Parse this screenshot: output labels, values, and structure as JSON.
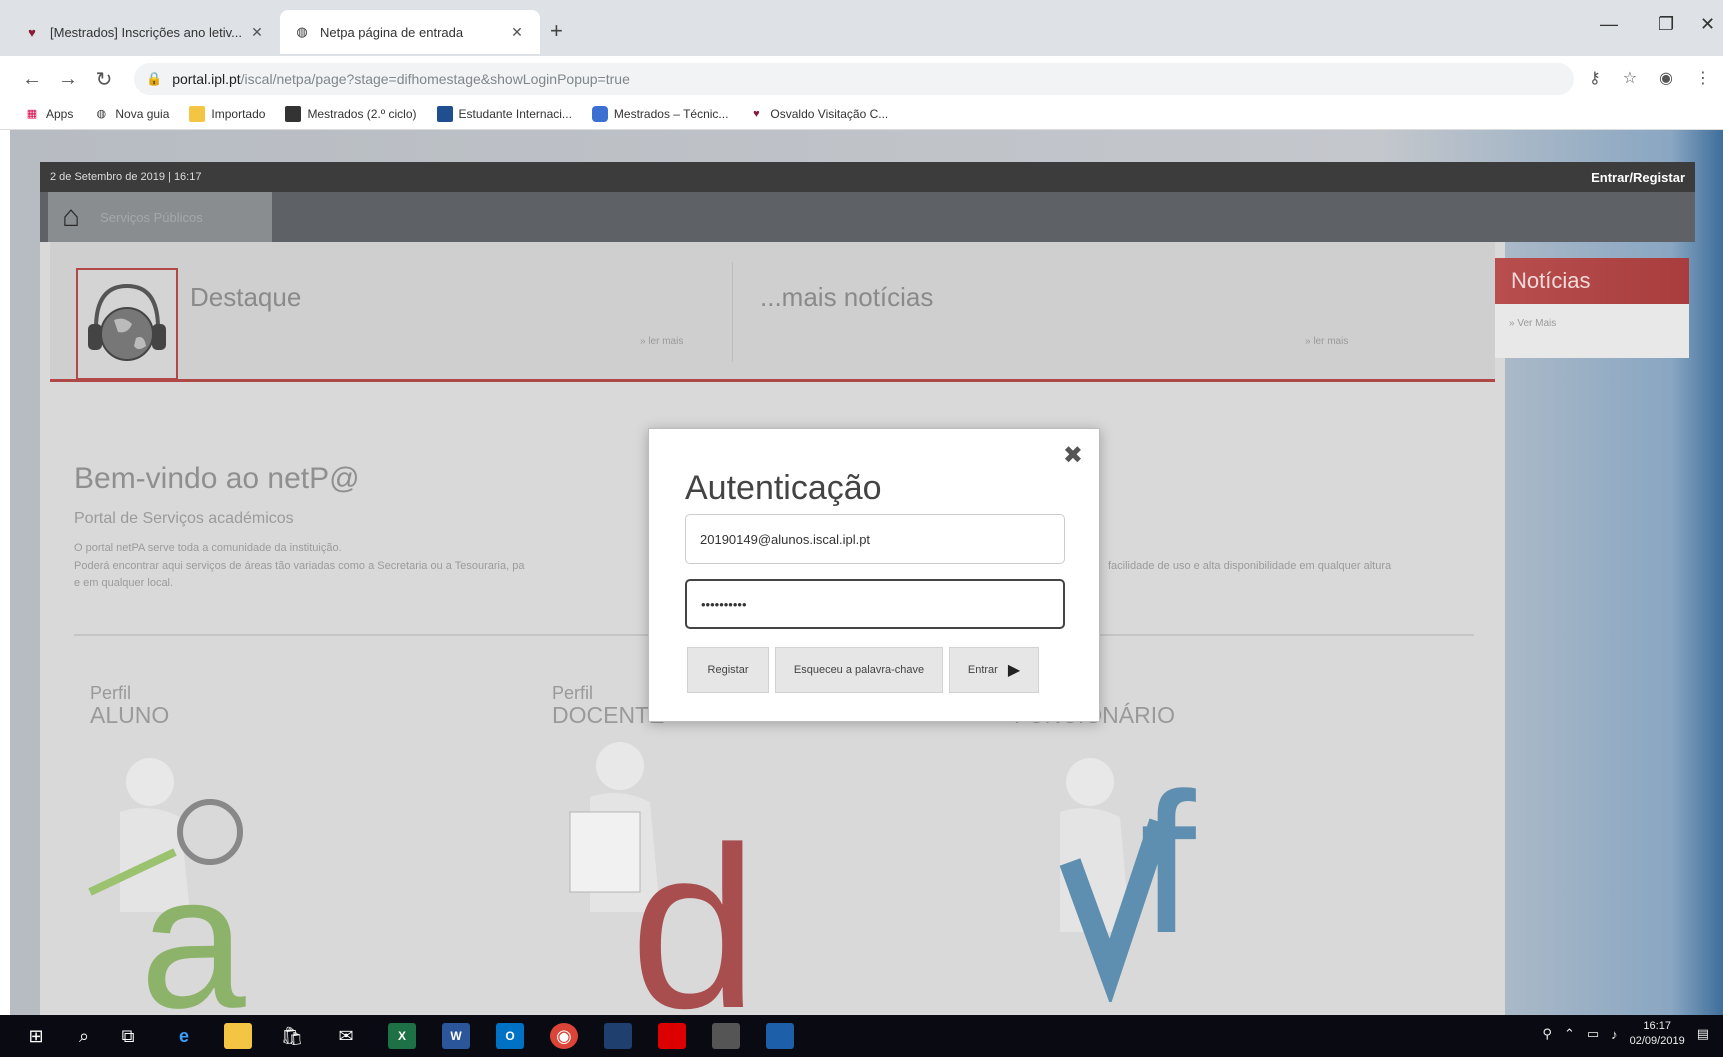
{
  "browser": {
    "tabs": [
      {
        "title": "[Mestrados] Inscrições ano letiv...",
        "active": false
      },
      {
        "title": "Netpa página de entrada",
        "active": true
      }
    ],
    "url_host": "portal.ipl.pt",
    "url_path": "/iscal/netpa/page?stage=difhomestage&showLoginPopup=true",
    "bookmarks": [
      "Apps",
      "Nova guia",
      "Importado",
      "Mestrados (2.º ciclo)",
      "Estudante Internaci...",
      "Mestrados – Técnic...",
      "Osvaldo Visitação C..."
    ]
  },
  "site": {
    "date_line": "2 de Setembro de 2019 | 16:17",
    "login_link": "Entrar/Registar",
    "menu_home_label": "Serviços Públicos",
    "destaque_title": "Destaque",
    "destaque_more": "» ler mais",
    "mais_title": "...mais notícias",
    "mais_more": "» ler mais",
    "welcome_title": "Bem-vindo ao netP@",
    "welcome_sub": "Portal de Serviços académicos",
    "welcome_p1": "O portal netPA serve toda a comunidade da instituição.",
    "welcome_p2": "Poderá encontrar aqui serviços de áreas tão variadas como a Secretaria ou a Tesouraria, pa",
    "welcome_p2_tail": "facilidade de uso e alta disponibilidade em qualquer altura",
    "welcome_p3": "e em qualquer local.",
    "perfis": [
      {
        "small": "Perfil",
        "big": "ALUNO",
        "letter": "a",
        "color": "#8db36a"
      },
      {
        "small": "Perfil",
        "big": "DOCENTE",
        "letter": "d",
        "color": "#a84e4e"
      },
      {
        "small": "Perfil",
        "big": "FUNCIONÁRIO",
        "letter": "f",
        "color": "#5e8fb0"
      }
    ],
    "noticias_title": "Notícias",
    "noticias_more": "» Ver Mais"
  },
  "modal": {
    "title": "Autenticação",
    "username_value": "20190149@alunos.iscal.ipl.pt",
    "password_value": "••••••••••",
    "buttons": {
      "register": "Registar",
      "forgot": "Esqueceu a palavra-chave",
      "enter": "Entrar"
    }
  },
  "taskbar": {
    "time": "16:17",
    "date": "02/09/2019"
  }
}
